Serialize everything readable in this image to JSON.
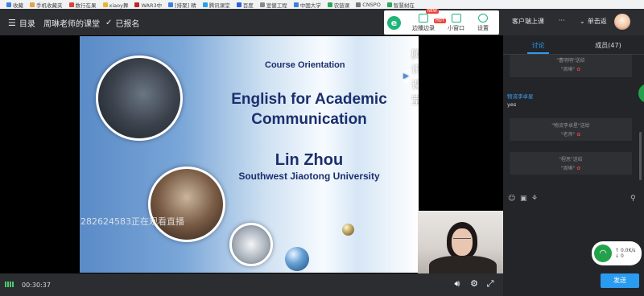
{
  "bookmarks": [
    "收藏",
    "手机收藏夹",
    "数行在果",
    "xiaoy舞",
    "WAR3中",
    "[排聚] 精",
    "腾讯课堂",
    "百度",
    "室健工程",
    "中国大学",
    "农链课",
    "CNSPO",
    "智慧树在"
  ],
  "topbar": {
    "menu_label": "目录",
    "course_title": "周琳老师的课堂",
    "enrolled_label": "已报名",
    "tools": {
      "present_label": "边播边录",
      "mini_label": "小窗口",
      "settings_label": "设置",
      "new_badge": "NEW",
      "hot_badge": "HOT"
    },
    "client_label": "客户端上课",
    "more_label": "···",
    "single_label": "单击返"
  },
  "slide": {
    "orientation": "Course Orientation",
    "title": "English for Academic Communication",
    "name": "Lin Zhou",
    "university": "Southwest Jiaotong University",
    "brand": "腾讯课堂"
  },
  "watermark": "282624583正在观看直播",
  "player": {
    "time": "00:30:37"
  },
  "sidebar": {
    "tab_discussion": "讨论",
    "tab_members": "成员(47)",
    "system_messages": [
      {
        "line1": "\"曹明明\"送给",
        "line2": "\"周琳\""
      },
      {
        "line1": "\"物流李卓星\"送给",
        "line2": "\"老师\""
      },
      {
        "line1": "\"程思\"送给",
        "line2": "\"周琳\""
      }
    ],
    "message": {
      "author": "物流李卓星",
      "text": "yes"
    },
    "send_label": "发送",
    "network": {
      "up": "0.0K/s",
      "down": "0"
    }
  },
  "colors": {
    "accent": "#2b9bf0",
    "green": "#23a24b",
    "slide_text": "#1b2f6e"
  }
}
